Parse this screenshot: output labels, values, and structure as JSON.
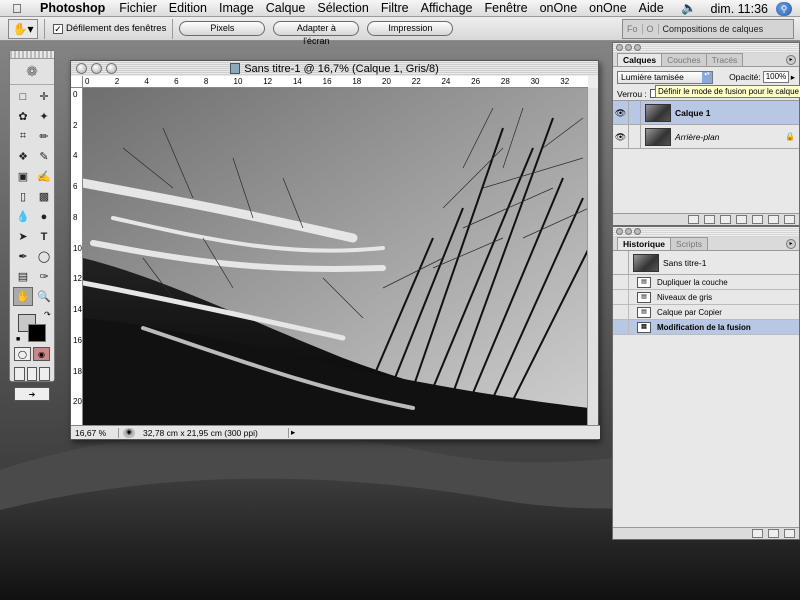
{
  "menubar": {
    "app": "Photoshop",
    "items": [
      "Fichier",
      "Edition",
      "Image",
      "Calque",
      "Sélection",
      "Filtre",
      "Affichage",
      "Fenêtre",
      "onOne",
      "onOne",
      "Aide"
    ],
    "clock": "dim. 11:36"
  },
  "options": {
    "scroll_all_label": "Défilement des fenêtres",
    "pixels": "Pixels",
    "fit_screen": "Adapter à l'écran",
    "print": "Impression",
    "well_tabs": [
      "Fo",
      "O"
    ],
    "well_label": "Compositions de calques"
  },
  "document": {
    "title": "Sans titre-1 @ 16,7% (Calque 1, Gris/8)",
    "zoom": "16,67 %",
    "info": "32,78 cm x 21,95 cm (300 ppi)",
    "ruler_h": [
      "0",
      "2",
      "4",
      "6",
      "8",
      "10",
      "12",
      "14",
      "16",
      "18",
      "20",
      "22",
      "24",
      "26",
      "28",
      "30",
      "32"
    ],
    "ruler_v": [
      "0",
      "2",
      "4",
      "6",
      "8",
      "10",
      "12",
      "14",
      "16",
      "18",
      "20"
    ]
  },
  "layers": {
    "tabs": [
      "Calques",
      "Couches",
      "Tracés"
    ],
    "blend_mode": "Lumière tamisée",
    "opacity_label": "Opacité:",
    "opacity_value": "100%",
    "lock_label": "Verrou :",
    "tooltip": "Définir le mode de fusion pour le calque",
    "rows": [
      {
        "name": "Calque 1"
      },
      {
        "name": "Arrière-plan"
      }
    ]
  },
  "history": {
    "tabs": [
      "Historique",
      "Scripts"
    ],
    "snapshot": "Sans titre-1",
    "steps": [
      {
        "label": "Dupliquer la couche"
      },
      {
        "label": "Niveaux de gris"
      },
      {
        "label": "Calque par Copier"
      },
      {
        "label": "Modification de la fusion"
      }
    ]
  },
  "colors": {
    "selection": "#b8c8e4",
    "spotlight": "#2a5caa"
  }
}
